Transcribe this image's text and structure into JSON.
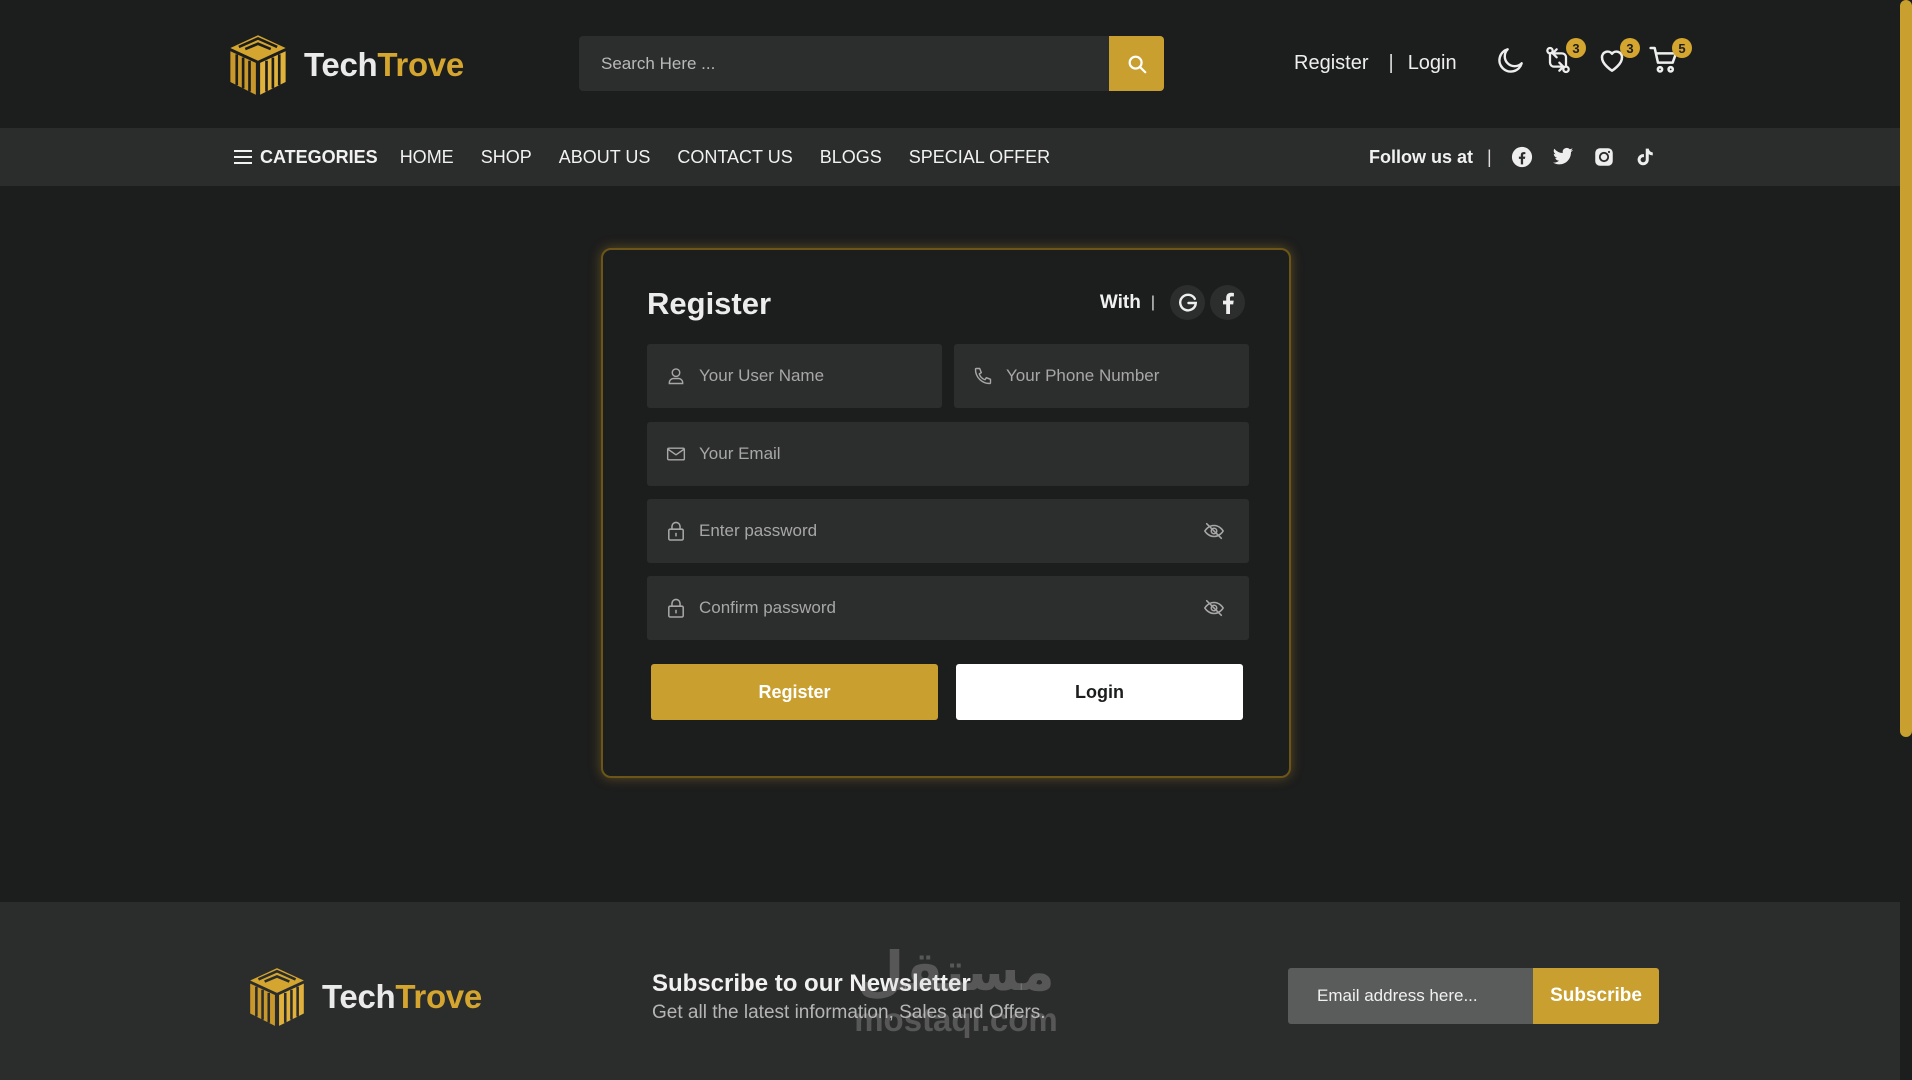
{
  "brand": {
    "name_part1": "Tech",
    "name_part2": "Trove"
  },
  "search": {
    "placeholder": "Search Here ..."
  },
  "header": {
    "register_label": "Register",
    "separator": "|",
    "login_label": "Login",
    "compare_count": "3",
    "wishlist_count": "3",
    "cart_count": "5"
  },
  "nav": {
    "categories_label": "CATEGORIES",
    "items": [
      {
        "label": "HOME"
      },
      {
        "label": "SHOP"
      },
      {
        "label": "ABOUT US"
      },
      {
        "label": "CONTACT US"
      },
      {
        "label": "BLOGS"
      },
      {
        "label": "SPECIAL OFFER"
      }
    ],
    "follow_label": "Follow us at",
    "separator": "|",
    "socials": [
      "facebook-icon",
      "twitter-icon",
      "instagram-icon",
      "tiktok-icon"
    ]
  },
  "form": {
    "title": "Register",
    "with_label": "With",
    "separator": "|",
    "username_placeholder": "Your User Name",
    "phone_placeholder": "Your Phone Number",
    "email_placeholder": "Your Email",
    "password_placeholder": "Enter password",
    "confirm_placeholder": "Confirm password",
    "register_button": "Register",
    "login_button": "Login"
  },
  "footer": {
    "newsletter_title": "Subscribe to our Newsletter",
    "newsletter_subtitle": "Get all the latest information, Sales and Offers.",
    "email_placeholder": "Email address here...",
    "subscribe_label": "Subscribe",
    "watermark_arabic": "مستقل",
    "watermark_latin": "mostaql.com"
  },
  "colors": {
    "accent": "#c9a02f",
    "background": "#1c1d1d",
    "panel": "#2b2c2c",
    "input": "#2c2d2d"
  }
}
